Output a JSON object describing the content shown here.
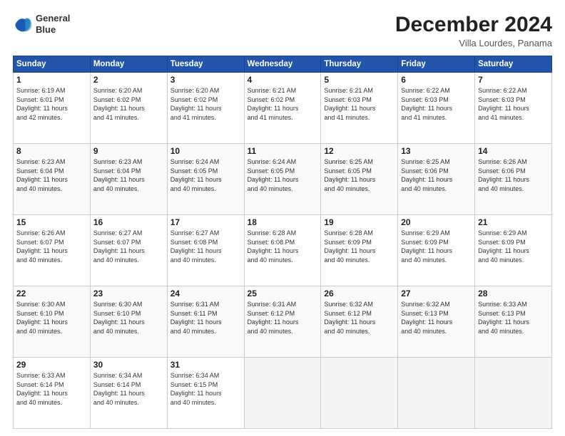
{
  "header": {
    "logo_line1": "General",
    "logo_line2": "Blue",
    "month_title": "December 2024",
    "subtitle": "Villa Lourdes, Panama"
  },
  "days_of_week": [
    "Sunday",
    "Monday",
    "Tuesday",
    "Wednesday",
    "Thursday",
    "Friday",
    "Saturday"
  ],
  "weeks": [
    [
      {
        "day": "1",
        "info": "Sunrise: 6:19 AM\nSunset: 6:01 PM\nDaylight: 11 hours\nand 42 minutes."
      },
      {
        "day": "2",
        "info": "Sunrise: 6:20 AM\nSunset: 6:02 PM\nDaylight: 11 hours\nand 41 minutes."
      },
      {
        "day": "3",
        "info": "Sunrise: 6:20 AM\nSunset: 6:02 PM\nDaylight: 11 hours\nand 41 minutes."
      },
      {
        "day": "4",
        "info": "Sunrise: 6:21 AM\nSunset: 6:02 PM\nDaylight: 11 hours\nand 41 minutes."
      },
      {
        "day": "5",
        "info": "Sunrise: 6:21 AM\nSunset: 6:03 PM\nDaylight: 11 hours\nand 41 minutes."
      },
      {
        "day": "6",
        "info": "Sunrise: 6:22 AM\nSunset: 6:03 PM\nDaylight: 11 hours\nand 41 minutes."
      },
      {
        "day": "7",
        "info": "Sunrise: 6:22 AM\nSunset: 6:03 PM\nDaylight: 11 hours\nand 41 minutes."
      }
    ],
    [
      {
        "day": "8",
        "info": "Sunrise: 6:23 AM\nSunset: 6:04 PM\nDaylight: 11 hours\nand 40 minutes."
      },
      {
        "day": "9",
        "info": "Sunrise: 6:23 AM\nSunset: 6:04 PM\nDaylight: 11 hours\nand 40 minutes."
      },
      {
        "day": "10",
        "info": "Sunrise: 6:24 AM\nSunset: 6:05 PM\nDaylight: 11 hours\nand 40 minutes."
      },
      {
        "day": "11",
        "info": "Sunrise: 6:24 AM\nSunset: 6:05 PM\nDaylight: 11 hours\nand 40 minutes."
      },
      {
        "day": "12",
        "info": "Sunrise: 6:25 AM\nSunset: 6:05 PM\nDaylight: 11 hours\nand 40 minutes."
      },
      {
        "day": "13",
        "info": "Sunrise: 6:25 AM\nSunset: 6:06 PM\nDaylight: 11 hours\nand 40 minutes."
      },
      {
        "day": "14",
        "info": "Sunrise: 6:26 AM\nSunset: 6:06 PM\nDaylight: 11 hours\nand 40 minutes."
      }
    ],
    [
      {
        "day": "15",
        "info": "Sunrise: 6:26 AM\nSunset: 6:07 PM\nDaylight: 11 hours\nand 40 minutes."
      },
      {
        "day": "16",
        "info": "Sunrise: 6:27 AM\nSunset: 6:07 PM\nDaylight: 11 hours\nand 40 minutes."
      },
      {
        "day": "17",
        "info": "Sunrise: 6:27 AM\nSunset: 6:08 PM\nDaylight: 11 hours\nand 40 minutes."
      },
      {
        "day": "18",
        "info": "Sunrise: 6:28 AM\nSunset: 6:08 PM\nDaylight: 11 hours\nand 40 minutes."
      },
      {
        "day": "19",
        "info": "Sunrise: 6:28 AM\nSunset: 6:09 PM\nDaylight: 11 hours\nand 40 minutes."
      },
      {
        "day": "20",
        "info": "Sunrise: 6:29 AM\nSunset: 6:09 PM\nDaylight: 11 hours\nand 40 minutes."
      },
      {
        "day": "21",
        "info": "Sunrise: 6:29 AM\nSunset: 6:09 PM\nDaylight: 11 hours\nand 40 minutes."
      }
    ],
    [
      {
        "day": "22",
        "info": "Sunrise: 6:30 AM\nSunset: 6:10 PM\nDaylight: 11 hours\nand 40 minutes."
      },
      {
        "day": "23",
        "info": "Sunrise: 6:30 AM\nSunset: 6:10 PM\nDaylight: 11 hours\nand 40 minutes."
      },
      {
        "day": "24",
        "info": "Sunrise: 6:31 AM\nSunset: 6:11 PM\nDaylight: 11 hours\nand 40 minutes."
      },
      {
        "day": "25",
        "info": "Sunrise: 6:31 AM\nSunset: 6:12 PM\nDaylight: 11 hours\nand 40 minutes."
      },
      {
        "day": "26",
        "info": "Sunrise: 6:32 AM\nSunset: 6:12 PM\nDaylight: 11 hours\nand 40 minutes."
      },
      {
        "day": "27",
        "info": "Sunrise: 6:32 AM\nSunset: 6:13 PM\nDaylight: 11 hours\nand 40 minutes."
      },
      {
        "day": "28",
        "info": "Sunrise: 6:33 AM\nSunset: 6:13 PM\nDaylight: 11 hours\nand 40 minutes."
      }
    ],
    [
      {
        "day": "29",
        "info": "Sunrise: 6:33 AM\nSunset: 6:14 PM\nDaylight: 11 hours\nand 40 minutes."
      },
      {
        "day": "30",
        "info": "Sunrise: 6:34 AM\nSunset: 6:14 PM\nDaylight: 11 hours\nand 40 minutes."
      },
      {
        "day": "31",
        "info": "Sunrise: 6:34 AM\nSunset: 6:15 PM\nDaylight: 11 hours\nand 40 minutes."
      },
      {
        "day": "",
        "info": ""
      },
      {
        "day": "",
        "info": ""
      },
      {
        "day": "",
        "info": ""
      },
      {
        "day": "",
        "info": ""
      }
    ]
  ]
}
